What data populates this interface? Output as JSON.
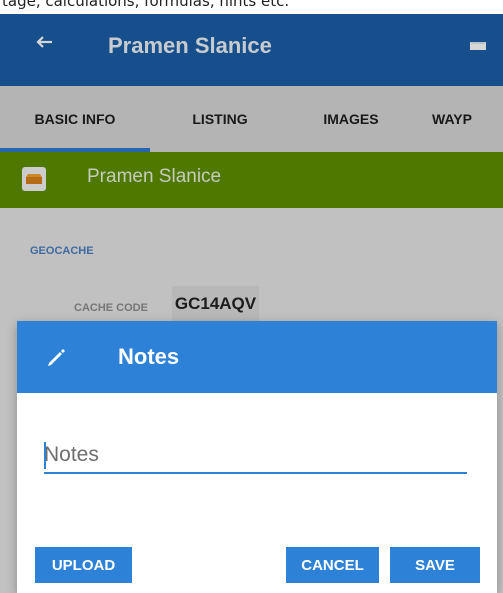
{
  "top_text": "tage, calculations, formulas, hints etc.",
  "appbar": {
    "title": "Pramen Slanice",
    "back_icon": "arrow-back-icon",
    "action_icon": "bookmark-icon"
  },
  "tabs": [
    {
      "label": "BASIC INFO",
      "active": true
    },
    {
      "label": "LISTING",
      "active": false
    },
    {
      "label": "IMAGES",
      "active": false
    },
    {
      "label": "WAYP",
      "active": false
    }
  ],
  "cache_header": {
    "icon": "geocache-icon",
    "title": "Pramen Slanice"
  },
  "section": {
    "title": "GEOCACHE",
    "cache_code_label": "CACHE CODE",
    "cache_code_value": "GC14AQV"
  },
  "dialog": {
    "icon": "pencil-icon",
    "title": "Notes",
    "input": {
      "placeholder": "Notes",
      "value": ""
    },
    "buttons": {
      "upload": "UPLOAD",
      "cancel": "CANCEL",
      "save": "SAVE"
    }
  },
  "colors": {
    "appbar": "#1b5fa6",
    "accent": "#2d82d7",
    "green": "#5e8f00"
  }
}
